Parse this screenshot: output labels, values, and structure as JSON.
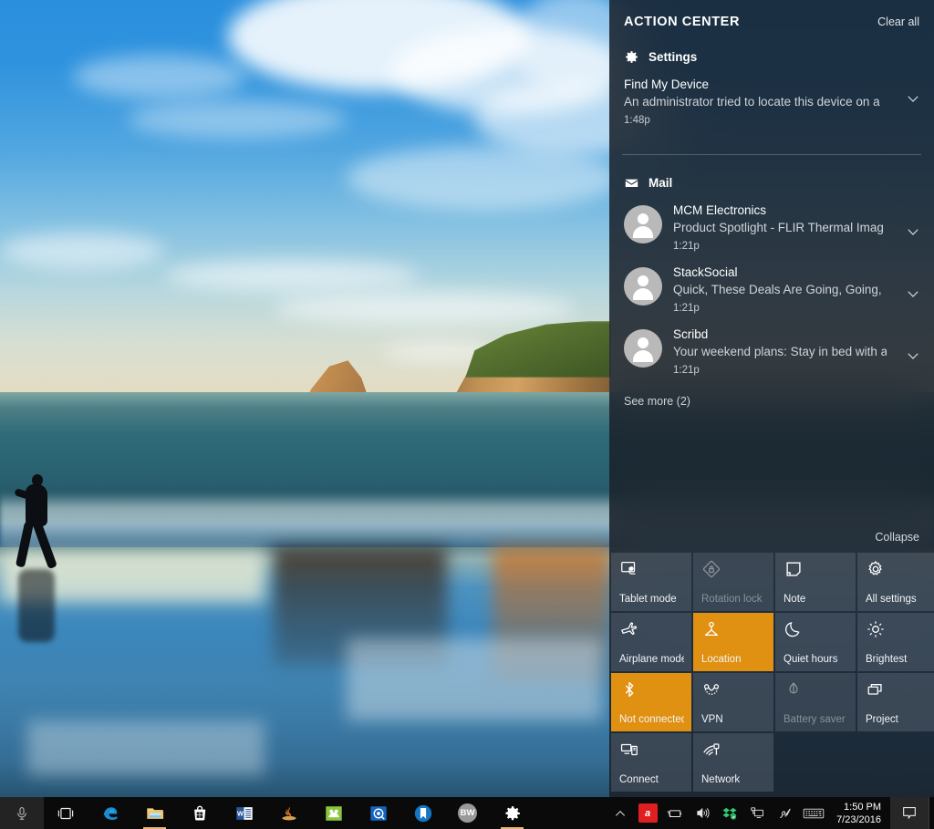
{
  "action_center": {
    "title": "ACTION CENTER",
    "clear_all": "Clear all",
    "collapse": "Collapse",
    "groups": [
      {
        "id": "settings",
        "icon": "gear-icon",
        "name": "Settings",
        "notifications": [
          {
            "title": "Find My Device",
            "text": "An administrator tried to locate this device on a",
            "time": "1:48p",
            "has_avatar": false
          }
        ]
      },
      {
        "id": "mail",
        "icon": "mail-icon",
        "name": "Mail",
        "see_more": "See more (2)",
        "notifications": [
          {
            "title": "MCM Electronics",
            "text": "Product Spotlight - FLIR Thermal Imag",
            "time": "1:21p",
            "has_avatar": true
          },
          {
            "title": "StackSocial",
            "text": "Quick, These Deals Are Going, Going, ",
            "time": "1:21p",
            "has_avatar": true
          },
          {
            "title": "Scribd",
            "text": "Your weekend plans: Stay in bed with a",
            "time": "1:21p",
            "has_avatar": true
          }
        ]
      }
    ],
    "quick_actions": [
      {
        "label": "Tablet mode",
        "icon": "tablet-mode-icon",
        "state": "off"
      },
      {
        "label": "Rotation lock",
        "icon": "rotation-lock-icon",
        "state": "disabled"
      },
      {
        "label": "Note",
        "icon": "note-icon",
        "state": "off"
      },
      {
        "label": "All settings",
        "icon": "gear-icon",
        "state": "off"
      },
      {
        "label": "Airplane mode",
        "icon": "airplane-icon",
        "state": "off"
      },
      {
        "label": "Location",
        "icon": "location-icon",
        "state": "on"
      },
      {
        "label": "Quiet hours",
        "icon": "moon-icon",
        "state": "off"
      },
      {
        "label": "Brightest",
        "icon": "brightness-icon",
        "state": "off"
      },
      {
        "label": "Not connected",
        "icon": "bluetooth-icon",
        "state": "on"
      },
      {
        "label": "VPN",
        "icon": "vpn-icon",
        "state": "off"
      },
      {
        "label": "Battery saver",
        "icon": "battery-saver-icon",
        "state": "disabled"
      },
      {
        "label": "Project",
        "icon": "project-icon",
        "state": "off"
      },
      {
        "label": "Connect",
        "icon": "connect-icon",
        "state": "off"
      },
      {
        "label": "Network",
        "icon": "network-icon",
        "state": "off"
      }
    ],
    "accent_color": "#e09112",
    "panel_color": "#181f29"
  },
  "taskbar": {
    "cortana": {
      "icon": "microphone-icon"
    },
    "task_view": {
      "icon": "task-view-icon"
    },
    "apps": [
      {
        "name": "Microsoft Edge",
        "icon": "edge-icon",
        "active": false
      },
      {
        "name": "File Explorer",
        "icon": "folder-icon",
        "active": true
      },
      {
        "name": "Microsoft Store",
        "icon": "store-icon",
        "active": false
      },
      {
        "name": "Microsoft Word",
        "icon": "word-icon",
        "active": false
      },
      {
        "name": "Java",
        "icon": "java-icon",
        "active": false
      },
      {
        "name": "Notes",
        "icon": "notes-icon",
        "active": false
      },
      {
        "name": "Media App",
        "icon": "media-icon",
        "active": false
      },
      {
        "name": "Bookmark App",
        "icon": "bookmark-icon",
        "active": false
      },
      {
        "name": "BW",
        "icon": "bw-icon",
        "active": false,
        "badge_text": "BW"
      },
      {
        "name": "Settings",
        "icon": "gear-icon",
        "active": true
      }
    ],
    "tray": [
      {
        "name": "show-hidden-icons",
        "icon": "chevron-up-icon"
      },
      {
        "name": "Avira",
        "icon": "avira-icon",
        "badge_text": "a"
      },
      {
        "name": "Battery",
        "icon": "battery-icon"
      },
      {
        "name": "Volume",
        "icon": "speaker-icon"
      },
      {
        "name": "Dropbox",
        "icon": "dropbox-icon"
      },
      {
        "name": "Network",
        "icon": "monitor-network-icon"
      },
      {
        "name": "Pen",
        "icon": "pen-icon"
      },
      {
        "name": "Touch keyboard",
        "icon": "keyboard-icon"
      }
    ],
    "clock": {
      "time": "1:50 PM",
      "date": "7/23/2016"
    },
    "notification_button": {
      "icon": "speech-bubble-icon"
    }
  }
}
